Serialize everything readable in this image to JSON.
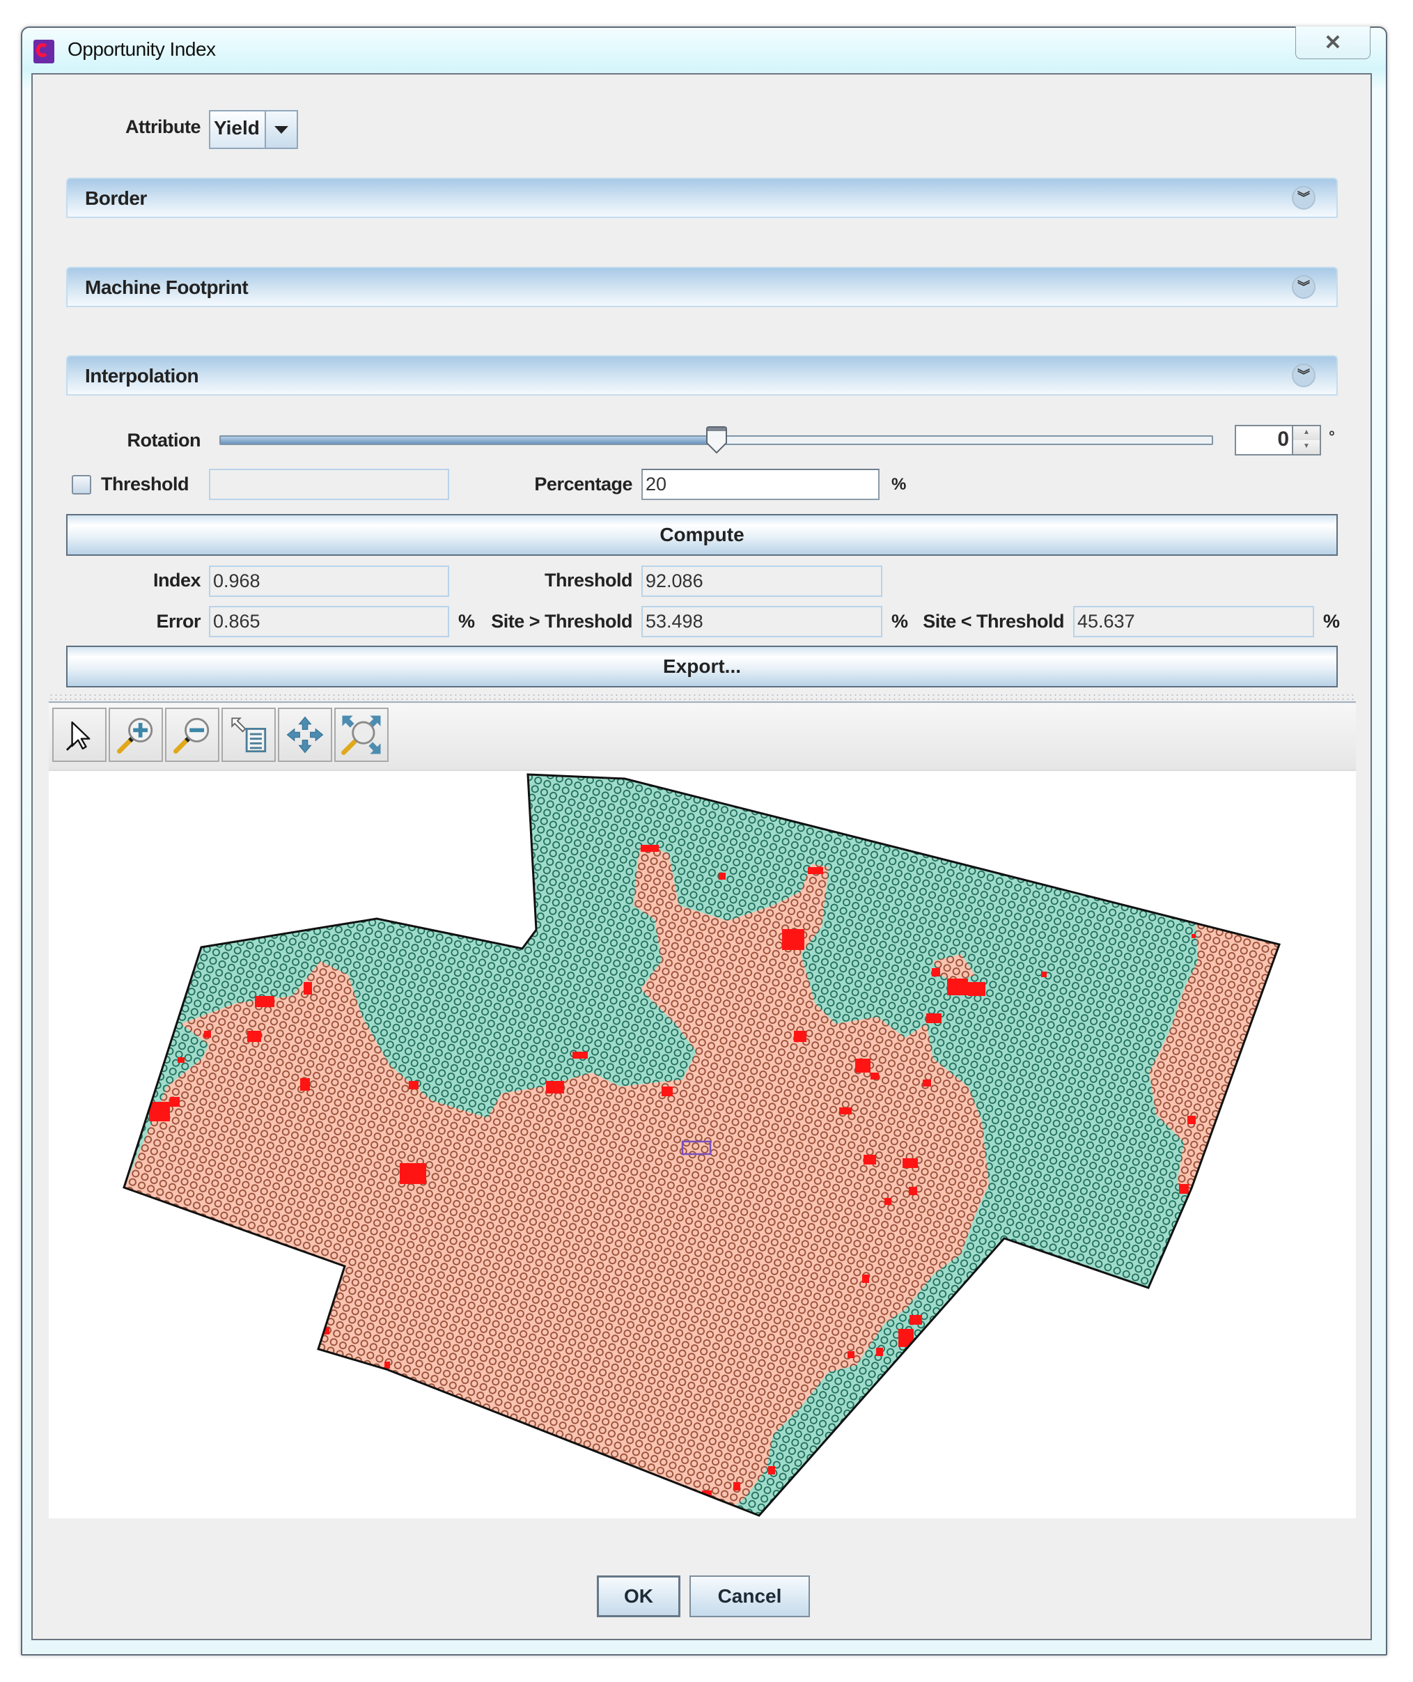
{
  "window": {
    "title": "Opportunity Index",
    "close_icon": "close-icon"
  },
  "attribute": {
    "label": "Attribute",
    "selected": "Yield"
  },
  "panels": [
    {
      "title": "Border",
      "icon": "double-chevron-down-icon"
    },
    {
      "title": "Machine Footprint",
      "icon": "double-chevron-down-icon"
    },
    {
      "title": "Interpolation",
      "icon": "double-chevron-down-icon"
    }
  ],
  "rotation": {
    "label": "Rotation",
    "value": "0",
    "unit": "°",
    "slider_position_fraction": 0.5
  },
  "threshold_input": {
    "label": "Threshold",
    "checked": false,
    "value": ""
  },
  "percentage": {
    "label": "Percentage",
    "value": "20",
    "unit": "%"
  },
  "buttons": {
    "compute": "Compute",
    "export": "Export...",
    "ok": "OK",
    "cancel": "Cancel"
  },
  "results": {
    "index_label": "Index",
    "index_value": "0.968",
    "threshold_label": "Threshold",
    "threshold_value": "92.086",
    "error_label": "Error",
    "error_value": "0.865",
    "error_unit": "%",
    "site_above_label": "Site > Threshold",
    "site_above_value": "53.498",
    "site_above_unit": "%",
    "site_below_label": "Site < Threshold",
    "site_below_value": "45.637",
    "site_below_unit": "%"
  },
  "map_toolbar": [
    {
      "name": "select-pointer",
      "icon": "pointer-icon"
    },
    {
      "name": "zoom-in",
      "icon": "zoom-in-icon"
    },
    {
      "name": "zoom-out",
      "icon": "zoom-out-icon"
    },
    {
      "name": "identify-info",
      "icon": "info-list-icon"
    },
    {
      "name": "pan",
      "icon": "pan-arrows-icon"
    },
    {
      "name": "zoom-extent",
      "icon": "zoom-extent-icon"
    }
  ],
  "map": {
    "description": "Field opportunity index map: sites above threshold (teal) and below threshold (salmon) with red boundary cells",
    "colors": {
      "above_fill": "#9fdccb",
      "above_points": "#1e6b59",
      "below_fill": "#f9c4b1",
      "below_points": "#9a4f38",
      "boundary_cells": "#ff1414",
      "outline": "#111111",
      "selection_box": "#7a4fc0"
    }
  }
}
